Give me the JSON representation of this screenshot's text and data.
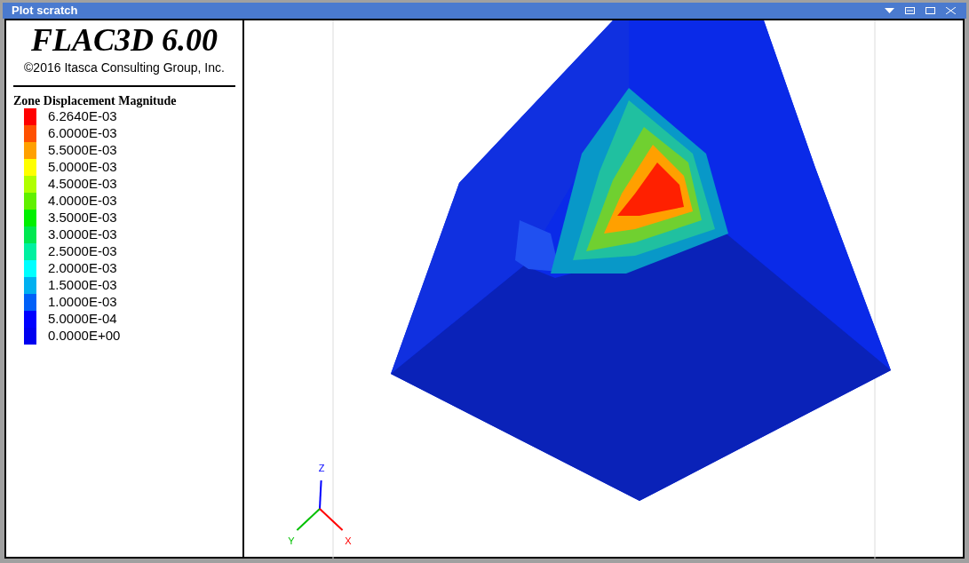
{
  "window": {
    "title": "Plot scratch"
  },
  "header": {
    "product": "FLAC3D 6.00",
    "copyright": "©2016 Itasca Consulting Group, Inc."
  },
  "legend": {
    "title": "Zone Displacement Magnitude",
    "items": [
      {
        "label": "6.2640E-03",
        "color": "#ff0000"
      },
      {
        "label": "6.0000E-03",
        "color": "#ff5000"
      },
      {
        "label": "5.5000E-03",
        "color": "#ffa000"
      },
      {
        "label": "5.0000E-03",
        "color": "#ffff00"
      },
      {
        "label": "4.5000E-03",
        "color": "#b0ff00"
      },
      {
        "label": "4.0000E-03",
        "color": "#60f000"
      },
      {
        "label": "3.5000E-03",
        "color": "#00f000"
      },
      {
        "label": "3.0000E-03",
        "color": "#00e850"
      },
      {
        "label": "2.5000E-03",
        "color": "#00f0a0"
      },
      {
        "label": "2.0000E-03",
        "color": "#00ffff"
      },
      {
        "label": "1.5000E-03",
        "color": "#00b0f0"
      },
      {
        "label": "1.0000E-03",
        "color": "#0060f8"
      },
      {
        "label": "5.0000E-04",
        "color": "#0000ff"
      },
      {
        "label": "0.0000E+00",
        "color": "#0000f0"
      }
    ]
  },
  "axes": [
    {
      "label": "Z",
      "color": "#0000ff"
    },
    {
      "label": "Y",
      "color": "#00c000"
    },
    {
      "label": "X",
      "color": "#ff0000"
    }
  ]
}
